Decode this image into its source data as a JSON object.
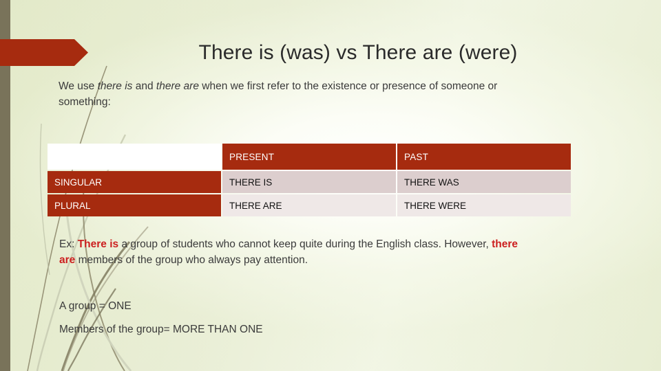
{
  "slide": {
    "title": "There is (was) vs There are (were)",
    "intro": {
      "part1": "We use ",
      "em1": "there is",
      "part2": " and ",
      "em2": "there are",
      "part3": " when we first refer to the existence or presence of someone or something:"
    },
    "table": {
      "corner_label": "",
      "column_headers": [
        "PRESENT",
        "PAST"
      ],
      "rows": [
        {
          "label": "SINGULAR",
          "cells": [
            "THERE IS",
            "THERE WAS"
          ]
        },
        {
          "label": "PLURAL",
          "cells": [
            "THERE ARE",
            "THERE WERE"
          ]
        }
      ]
    },
    "example": {
      "prefix": "Ex: ",
      "hl1": "There is",
      "mid": " a group of students who cannot keep quite during the English class. However, ",
      "hl2": "there are",
      "suffix": " members of the group who always pay attention."
    },
    "notes": [
      "A group = ONE",
      "Members of the group= MORE THAN ONE"
    ]
  },
  "theme": {
    "accent_red": "#a62b0f",
    "highlight_red": "#cc1f1f",
    "olive_band": "#79735a",
    "background_green": "#e6ecd0",
    "row_tint_a": "#dccece",
    "row_tint_b": "#efe8e7",
    "text_color": "#3a3a3a"
  },
  "decor": {
    "banner_arrow": "right-arrow-banner",
    "grass_blades": "grass-blades-decoration"
  }
}
